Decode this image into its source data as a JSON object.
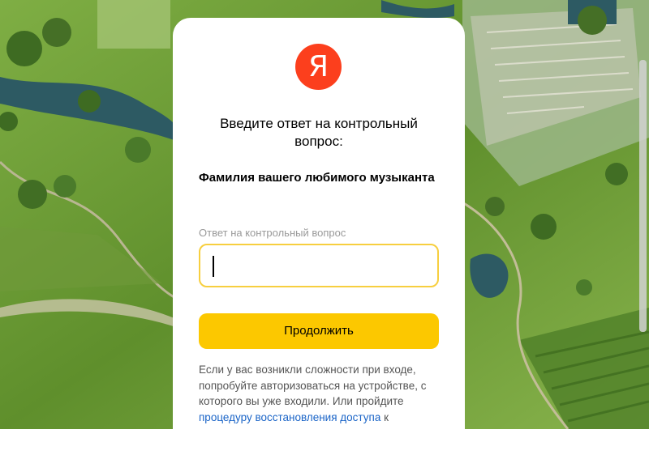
{
  "logo": {
    "letter": "Я"
  },
  "title": "Введите ответ на контрольный вопрос:",
  "question": "Фамилия вашего любимого музыканта",
  "answer_field": {
    "label": "Ответ на контрольный вопрос",
    "value": ""
  },
  "continue_button": "Продолжить",
  "help": {
    "text_before": "Если у вас возникли сложности при входе, попробуйте авторизоваться на устройстве, с которого вы уже входили. Или пройдите",
    "link": "процедуру восстановления доступа",
    "text_after": "к"
  },
  "colors": {
    "brand_red": "#fc3f1d",
    "button_yellow": "#fcc800",
    "input_border": "#f7cf3f",
    "link_blue": "#1a64c7"
  }
}
